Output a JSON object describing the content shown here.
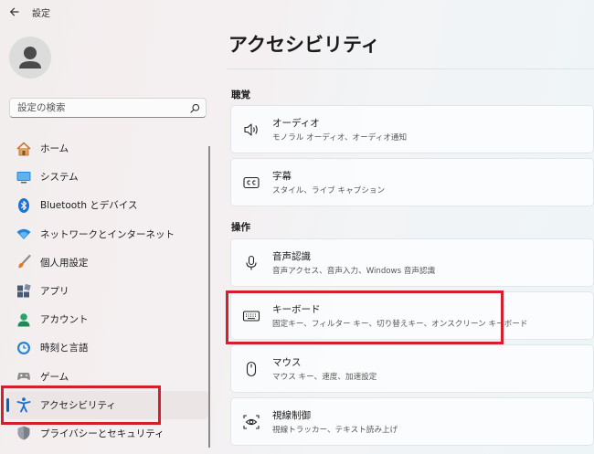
{
  "app": {
    "title": "設定"
  },
  "search": {
    "placeholder": "設定の検索"
  },
  "sidebar": {
    "items": [
      {
        "label": "ホーム"
      },
      {
        "label": "システム"
      },
      {
        "label": "Bluetooth とデバイス"
      },
      {
        "label": "ネットワークとインターネット"
      },
      {
        "label": "個人用設定"
      },
      {
        "label": "アプリ"
      },
      {
        "label": "アカウント"
      },
      {
        "label": "時刻と言語"
      },
      {
        "label": "ゲーム"
      },
      {
        "label": "アクセシビリティ"
      },
      {
        "label": "プライバシーとセキュリティ"
      }
    ],
    "selected": "アクセシビリティ"
  },
  "main": {
    "title": "アクセシビリティ",
    "sections": [
      {
        "label": "聴覚",
        "cards": [
          {
            "title": "オーディオ",
            "subtitle": "モノラル オーディオ、オーディオ通知",
            "icon": "speaker-icon"
          },
          {
            "title": "字幕",
            "subtitle": "スタイル、ライブ キャプション",
            "icon": "closed-caption-icon"
          }
        ]
      },
      {
        "label": "操作",
        "cards": [
          {
            "title": "音声認識",
            "subtitle": "音声アクセス、音声入力、Windows 音声認識",
            "icon": "microphone-icon"
          },
          {
            "title": "キーボード",
            "subtitle": "固定キー、フィルター キー、切り替えキー、オンスクリーン キーボード",
            "icon": "keyboard-icon"
          },
          {
            "title": "マウス",
            "subtitle": "マウス キー、速度、加速設定",
            "icon": "mouse-icon"
          },
          {
            "title": "視線制御",
            "subtitle": "視線トラッカー、テキスト読み上げ",
            "icon": "eye-control-icon"
          }
        ]
      }
    ]
  },
  "colors": {
    "accent": "#0067c0",
    "highlight": "#d4202c"
  }
}
